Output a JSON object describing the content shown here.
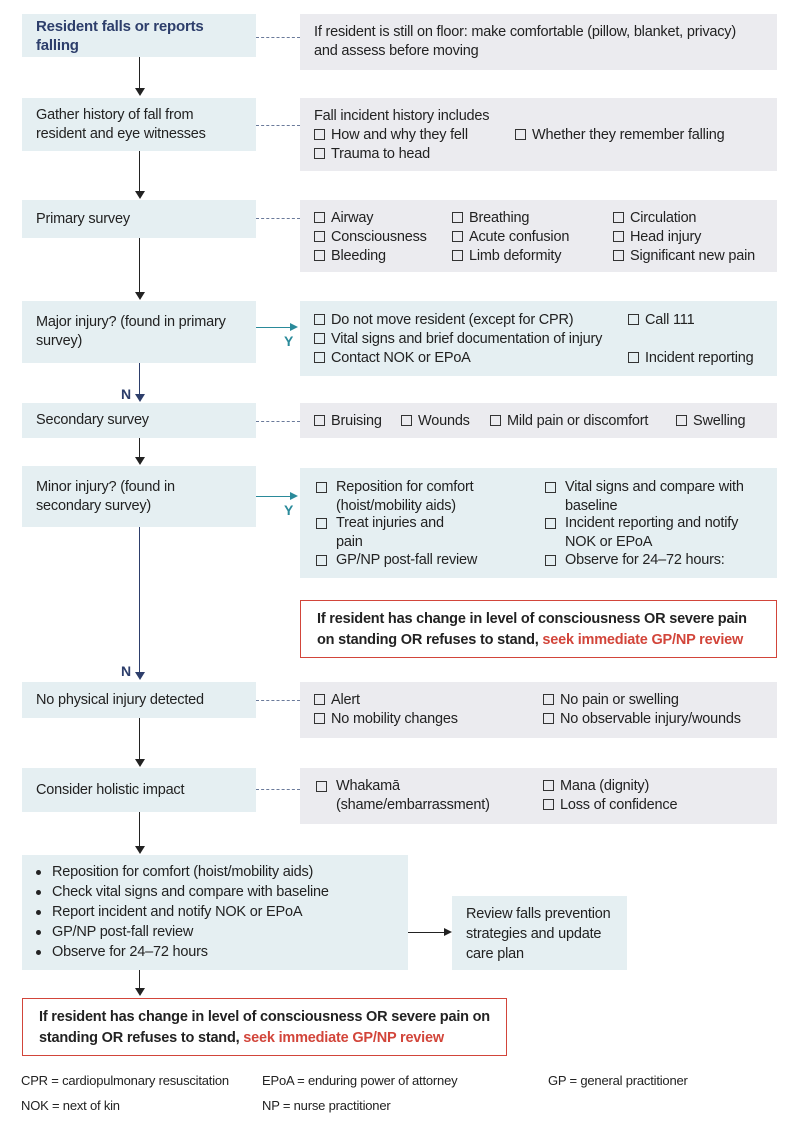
{
  "colors": {
    "step_box": "#e5eff2",
    "detail_box": "#ebebef",
    "title": "#2d3e6b",
    "yes_arrow": "#2a8a9a",
    "alert": "#d2453a"
  },
  "step1": {
    "label": "Resident falls or reports falling",
    "detail": "If resident is still on floor: make comfortable (pillow, blanket, privacy) and assess before moving"
  },
  "step2": {
    "label": "Gather history of fall from resident and eye witnesses",
    "detail_title": "Fall incident history includes",
    "items": [
      "How and why they fell",
      "Whether they remember falling",
      "Trauma to head"
    ]
  },
  "step3": {
    "label": "Primary survey",
    "items": [
      "Airway",
      "Breathing",
      "Circulation",
      "Consciousness",
      "Acute confusion",
      "Head injury",
      "Bleeding",
      "Limb deformity",
      "Significant new pain"
    ]
  },
  "step4": {
    "label": "Major injury? (found in primary survey)",
    "yes": "Y",
    "no": "N",
    "items": [
      "Do not move resident (except for CPR)",
      "Call 111",
      "Vital signs and brief documentation of injury",
      "Contact NOK or EPoA",
      "Incident reporting"
    ]
  },
  "step5": {
    "label": "Secondary survey",
    "items": [
      "Bruising",
      "Wounds",
      "Mild pain or discomfort",
      "Swelling"
    ]
  },
  "step6": {
    "label": "Minor injury? (found in secondary survey)",
    "yes": "Y",
    "no": "N",
    "items": [
      "Reposition for comfort (hoist/mobility aids)",
      "Vital signs and compare with baseline",
      "Treat injuries and pain",
      "Incident reporting and notify NOK or EPoA",
      "GP/NP post-fall review",
      "Observe for 24–72 hours:"
    ]
  },
  "alert1": {
    "text": "If resident has change in level of consciousness OR severe pain on standing OR refuses to stand, ",
    "highlight": "seek immediate GP/NP review"
  },
  "step7": {
    "label": "No physical injury detected",
    "items": [
      "Alert",
      "No pain or swelling",
      "No mobility changes",
      "No observable injury/wounds"
    ]
  },
  "step8": {
    "label": "Consider holistic impact",
    "items": [
      "Whakamā (shame/embarrassment)",
      "Mana (dignity)",
      "Loss of confidence"
    ]
  },
  "actions": [
    "Reposition for comfort (hoist/mobility aids)",
    "Check vital signs and compare with baseline",
    "Report incident and notify NOK or EPoA",
    "GP/NP post-fall review",
    "Observe for 24–72 hours"
  ],
  "review": "Review falls prevention strategies and update care plan",
  "alert2": {
    "text": "If resident has change in level of consciousness OR severe pain on standing OR refuses to stand, ",
    "highlight": "seek immediate GP/NP review"
  },
  "legend": [
    "CPR = cardiopulmonary resuscitation",
    "EPoA = enduring power of attorney",
    "GP = general practitioner",
    "NOK = next of kin",
    "NP = nurse practitioner"
  ]
}
